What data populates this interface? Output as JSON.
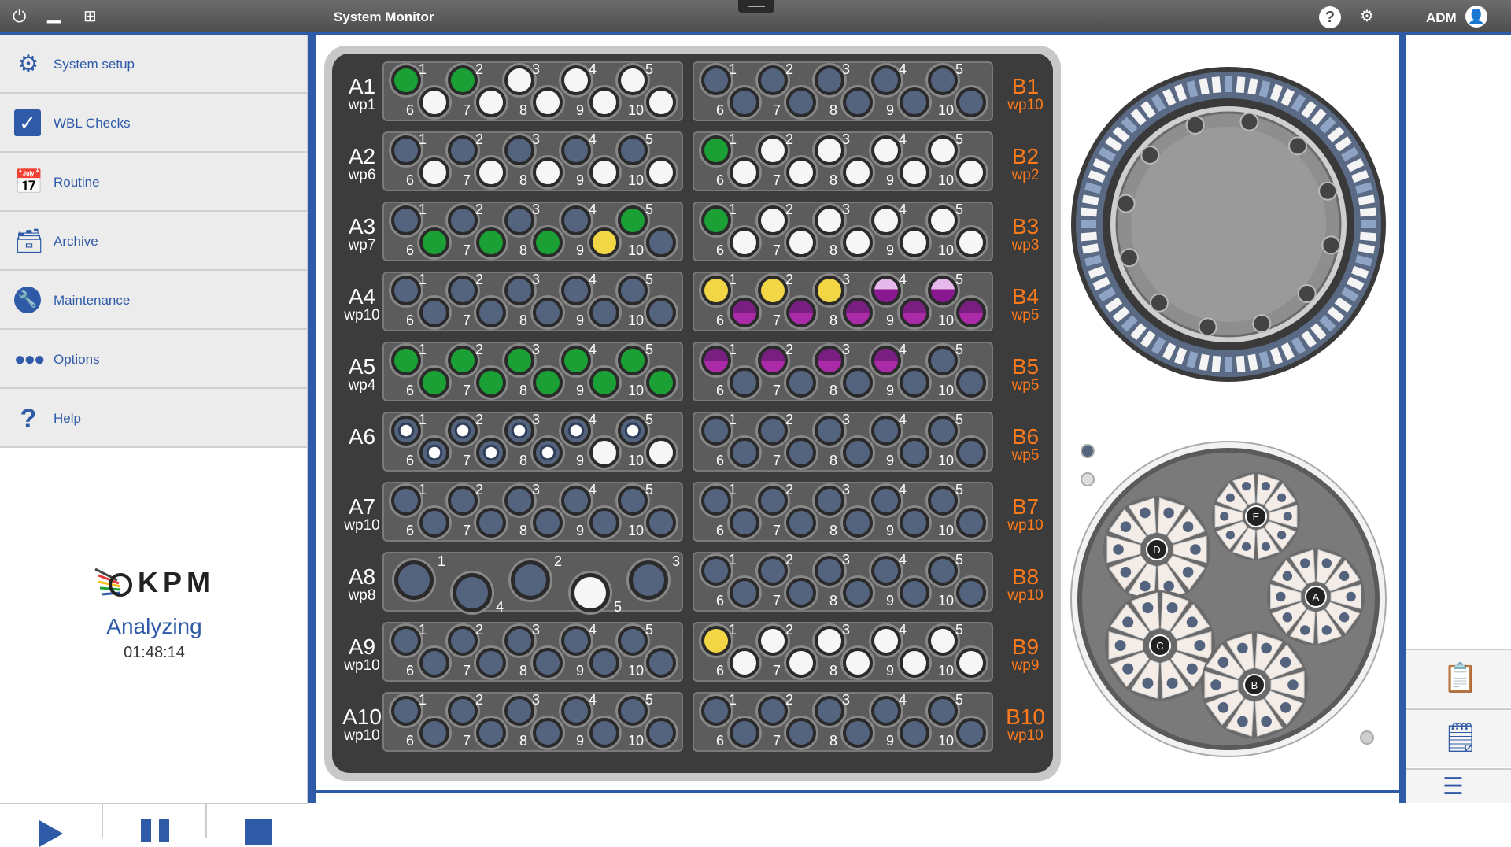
{
  "titlebar": {
    "title": "System Monitor",
    "user": "ADM",
    "icons": [
      "power-icon",
      "minimize-icon",
      "windows-icon",
      "help-icon",
      "user-settings-icon",
      "user-icon"
    ]
  },
  "sidebar": {
    "items": [
      {
        "label": "System setup",
        "icon": "gear-icon"
      },
      {
        "label": "WBL Checks",
        "icon": "checkbox-icon"
      },
      {
        "label": "Routine",
        "icon": "calendar-icon"
      },
      {
        "label": "Archive",
        "icon": "archive-tray-icon"
      },
      {
        "label": "Maintenance",
        "icon": "wrench-icon"
      },
      {
        "label": "Options",
        "icon": "dots-icon"
      },
      {
        "label": "Help",
        "icon": "question-icon"
      }
    ]
  },
  "status": {
    "brand": "KPM",
    "state": "Analyzing",
    "time": "01:48:14"
  },
  "controls": [
    "play-icon",
    "pause-icon",
    "stop-icon"
  ],
  "colors": {
    "accent": "#2e5aa8",
    "rack_bg": "#3c3c3c",
    "b_label": "#ff7a1a",
    "empty": "#54637e",
    "green": "#1aa034",
    "white": "#f6f6f6",
    "yellow": "#f3d645",
    "purple": "#8a1890"
  },
  "rack": {
    "rows": [
      {
        "a_label": "A1",
        "a_wp": "wp1",
        "b_label": "B1",
        "b_wp": "wp10",
        "a_cups": [
          "green",
          "green",
          "white",
          "white",
          "white",
          "white",
          "white",
          "white",
          "white",
          "white"
        ],
        "b_cups": [
          "empty",
          "empty",
          "empty",
          "empty",
          "empty",
          "empty",
          "empty",
          "empty",
          "empty",
          "empty"
        ]
      },
      {
        "a_label": "A2",
        "a_wp": "wp6",
        "b_label": "B2",
        "b_wp": "wp2",
        "a_cups": [
          "empty",
          "empty",
          "empty",
          "empty",
          "empty",
          "white",
          "white",
          "white",
          "white",
          "white"
        ],
        "b_cups": [
          "green",
          "white",
          "white",
          "white",
          "white",
          "white",
          "white",
          "white",
          "white",
          "white"
        ]
      },
      {
        "a_label": "A3",
        "a_wp": "wp7",
        "b_label": "B3",
        "b_wp": "wp3",
        "a_cups": [
          "empty",
          "empty",
          "empty",
          "empty",
          "green",
          "green",
          "green",
          "green",
          "yellow",
          "empty"
        ],
        "b_cups": [
          "green",
          "white",
          "white",
          "white",
          "white",
          "white",
          "white",
          "white",
          "white",
          "white"
        ]
      },
      {
        "a_label": "A4",
        "a_wp": "wp10",
        "b_label": "B4",
        "b_wp": "wp5",
        "a_cups": [
          "empty",
          "empty",
          "empty",
          "empty",
          "empty",
          "empty",
          "empty",
          "empty",
          "empty",
          "empty"
        ],
        "b_cups": [
          "yellow",
          "yellow",
          "yellow",
          "purpleb",
          "purpleb",
          "purple",
          "purple",
          "purple",
          "purple",
          "purple"
        ]
      },
      {
        "a_label": "A5",
        "a_wp": "wp4",
        "b_label": "B5",
        "b_wp": "wp5",
        "a_cups": [
          "green",
          "green",
          "green",
          "green",
          "green",
          "green",
          "green",
          "green",
          "green",
          "green"
        ],
        "b_cups": [
          "purple",
          "purple",
          "purple",
          "purple",
          "empty",
          "empty",
          "empty",
          "empty",
          "empty",
          "empty"
        ]
      },
      {
        "a_label": "A6",
        "a_wp": "",
        "b_label": "B6",
        "b_wp": "wp5",
        "a_cups": [
          "ring",
          "ring",
          "ring",
          "ring",
          "ring",
          "ring",
          "ring",
          "ring",
          "white",
          "white"
        ],
        "b_cups": [
          "empty",
          "empty",
          "empty",
          "empty",
          "empty",
          "empty",
          "empty",
          "empty",
          "empty",
          "empty"
        ]
      },
      {
        "a_label": "A7",
        "a_wp": "wp10",
        "b_label": "B7",
        "b_wp": "wp10",
        "a_cups": [
          "empty",
          "empty",
          "empty",
          "empty",
          "empty",
          "empty",
          "empty",
          "empty",
          "empty",
          "empty"
        ],
        "b_cups": [
          "empty",
          "empty",
          "empty",
          "empty",
          "empty",
          "empty",
          "empty",
          "empty",
          "empty",
          "empty"
        ]
      },
      {
        "a_label": "A8",
        "a_wp": "wp8",
        "b_label": "B8",
        "b_wp": "wp10",
        "a_big": [
          "empty",
          "empty",
          "empty",
          "white",
          "empty"
        ],
        "b_cups": [
          "empty",
          "empty",
          "empty",
          "empty",
          "empty",
          "empty",
          "empty",
          "empty",
          "empty",
          "empty"
        ]
      },
      {
        "a_label": "A9",
        "a_wp": "wp10",
        "b_label": "B9",
        "b_wp": "wp9",
        "a_cups": [
          "empty",
          "empty",
          "empty",
          "empty",
          "empty",
          "empty",
          "empty",
          "empty",
          "empty",
          "empty"
        ],
        "b_cups": [
          "yellow",
          "white",
          "white",
          "white",
          "white",
          "white",
          "white",
          "white",
          "white",
          "white"
        ]
      },
      {
        "a_label": "A10",
        "a_wp": "wp10",
        "b_label": "B10",
        "b_wp": "wp10",
        "a_cups": [
          "empty",
          "empty",
          "empty",
          "empty",
          "empty",
          "empty",
          "empty",
          "empty",
          "empty",
          "empty"
        ],
        "b_cups": [
          "empty",
          "empty",
          "empty",
          "empty",
          "empty",
          "empty",
          "empty",
          "empty",
          "empty",
          "empty"
        ]
      }
    ],
    "pos_top": [
      "1",
      "2",
      "3",
      "4",
      "5"
    ],
    "pos_bottom": [
      "6",
      "7",
      "8",
      "9",
      "10"
    ],
    "a8_numbers": [
      "1",
      "4",
      "2",
      "5",
      "3"
    ]
  },
  "tray": {
    "hubs": [
      "D",
      "E",
      "A",
      "C",
      "B"
    ]
  },
  "rightpanel": {
    "buttons": [
      "clipboard-gear-icon",
      "clipboard-clock-icon",
      "list-icon"
    ]
  }
}
